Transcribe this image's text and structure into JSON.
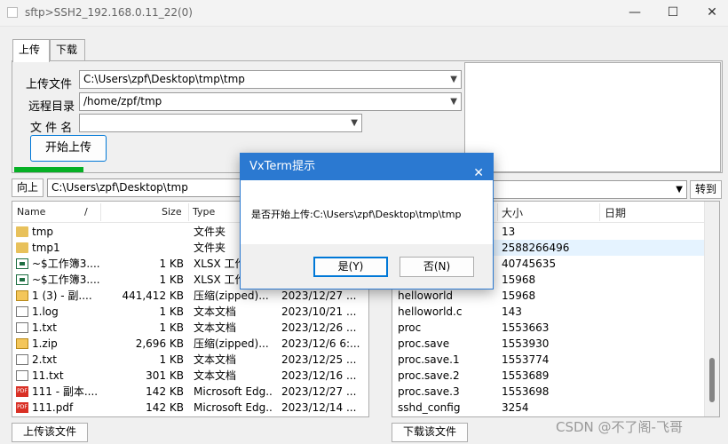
{
  "window": {
    "title": "sftp>SSH2_192.168.0.11_22(0)",
    "min_glyph": "—",
    "max_glyph": "☐",
    "close_glyph": "✕"
  },
  "tabs": [
    {
      "label": "上传"
    },
    {
      "label": "下载"
    }
  ],
  "upload_form": {
    "upload_file_label": "上传文件",
    "upload_file_value": "C:\\Users\\zpf\\Desktop\\tmp\\tmp",
    "remote_dir_label": "远程目录",
    "remote_dir_value": "/home/zpf/tmp",
    "filename_label": "文 件 名",
    "filename_value": "",
    "start_button": "开始上传",
    "progress": 1.0
  },
  "local": {
    "up_button": "向上",
    "path": "C:\\Users\\zpf\\Desktop\\tmp",
    "columns": [
      "Name",
      "/",
      "Size",
      "Type"
    ],
    "files": [
      {
        "name": "tmp",
        "size": "",
        "type": "文件夹",
        "date": "",
        "icon": "folder"
      },
      {
        "name": "tmp1",
        "size": "",
        "type": "文件夹",
        "date": "",
        "icon": "folder"
      },
      {
        "name": "~$工作簿3....",
        "size": "1 KB",
        "type": "XLSX 工作",
        "date": "",
        "icon": "xlsx"
      },
      {
        "name": "~$工作簿3....",
        "size": "1 KB",
        "type": "XLSX 工作",
        "date": "",
        "icon": "xlsx"
      },
      {
        "name": "1 (3) - 副....",
        "size": "441,412 KB",
        "type": "压缩(zipped)...",
        "date": "2023/12/27 ...",
        "icon": "zip"
      },
      {
        "name": "1.log",
        "size": "1 KB",
        "type": "文本文档",
        "date": "2023/10/21 ...",
        "icon": "txt"
      },
      {
        "name": "1.txt",
        "size": "1 KB",
        "type": "文本文档",
        "date": "2023/12/26 ...",
        "icon": "txt"
      },
      {
        "name": "1.zip",
        "size": "2,696 KB",
        "type": "压缩(zipped)...",
        "date": "2023/12/6 6:...",
        "icon": "zip"
      },
      {
        "name": "2.txt",
        "size": "1 KB",
        "type": "文本文档",
        "date": "2023/12/25 ...",
        "icon": "txt"
      },
      {
        "name": "11.txt",
        "size": "301 KB",
        "type": "文本文档",
        "date": "2023/12/16 ...",
        "icon": "txt"
      },
      {
        "name": "111 - 副本....",
        "size": "142 KB",
        "type": "Microsoft Edg...",
        "date": "2023/12/27 ...",
        "icon": "pdf"
      },
      {
        "name": "111.pdf",
        "size": "142 KB",
        "type": "Microsoft Edg...",
        "date": "2023/12/14 ...",
        "icon": "pdf"
      }
    ],
    "upload_button": "上传该文件"
  },
  "remote": {
    "goto_button": "转到",
    "columns": [
      "大小",
      "日期"
    ],
    "files": [
      {
        "name": "",
        "size": "13"
      },
      {
        "name": "",
        "size": "2588266496"
      },
      {
        "name": "",
        "size": "40745635"
      },
      {
        "name": "",
        "size": "15968"
      },
      {
        "name": "helloworld",
        "size": "15968"
      },
      {
        "name": "helloworld.c",
        "size": "143"
      },
      {
        "name": "proc",
        "size": "1553663"
      },
      {
        "name": "proc.save",
        "size": "1553930"
      },
      {
        "name": "proc.save.1",
        "size": "1553774"
      },
      {
        "name": "proc.save.2",
        "size": "1553689"
      },
      {
        "name": "proc.save.3",
        "size": "1553698"
      },
      {
        "name": "sshd_config",
        "size": "3254"
      }
    ],
    "download_button": "下载该文件"
  },
  "dialog": {
    "title": "VxTerm提示",
    "message": "是否开始上传:C:\\Users\\zpf\\Desktop\\tmp\\tmp",
    "yes_button": "是(Y)",
    "no_button": "否(N)",
    "close_glyph": "✕"
  },
  "watermark": "CSDN @不了阁-飞哥"
}
